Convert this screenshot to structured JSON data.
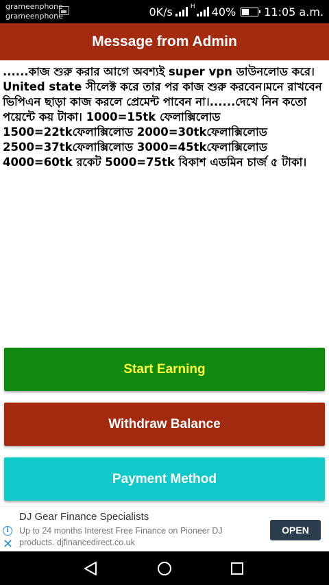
{
  "status_bar": {
    "carrier_1": "grameenphone",
    "carrier_2": "grameenphone",
    "speed": "0K/s",
    "network_type": "H",
    "battery": "40%",
    "time": "11:05 a.m."
  },
  "header": {
    "title": "Message from Admin"
  },
  "message": {
    "text": "......কাজ শুরু করার আগে অবশ্যই super vpn ডাউনলোড করে।United state সীলেক্ট করে তার পর কাজ শুরু করবেন।মনে রাখবেন ভিপিএন ছাড়া কাজ করলে প্রেমেন্ট পাবেন না।......দেখে নিন কতো পয়েন্টে কয় টাকা। 1000=15tk ফেলাক্সিলোড  1500=22tkফেলাক্সিলোড 2000=30tkফেলাক্সিলোড 2500=37tkফেলাক্সিলোড 3000=45tkফেলাক্সিলোড 4000=60tk রকেট 5000=75tk বিকাশ এডমিন চার্জ ৫ টাকা।"
  },
  "buttons": {
    "start_earning": "Start Earning",
    "withdraw_balance": "Withdraw Balance",
    "payment_method": "Payment Method"
  },
  "ad": {
    "title": "DJ Gear Finance Specialists",
    "description": "Up to 24 months Interest Free Finance on Pioneer DJ products. djfinancedirect.co.uk",
    "open_label": "OPEN",
    "info_icon": "i",
    "close_icon": "✕"
  },
  "colors": {
    "header": "#a3290f",
    "start_button": "#0f8a0f",
    "start_text": "#ffff33",
    "withdraw_button": "#a3290f",
    "payment_button": "#11c9c9"
  }
}
